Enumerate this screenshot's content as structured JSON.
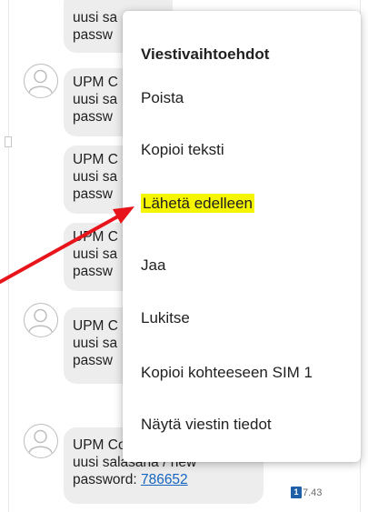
{
  "messages": [
    {
      "lines": [
        "uusi sa",
        "passw"
      ]
    },
    {
      "lines": [
        "UPM C",
        "uusi sa",
        "passw"
      ]
    },
    {
      "lines": [
        "UPM C",
        "uusi sa",
        "passw"
      ]
    },
    {
      "lines": [
        "UPM C",
        "uusi sa",
        "passw"
      ]
    },
    {
      "lines": [
        "UPM C",
        "uusi sa",
        "passw"
      ]
    },
    {
      "line1": "UPM Contractor Portal",
      "line2": "uusi salasana / new",
      "line3_prefix": "password: ",
      "code": "786652"
    }
  ],
  "timestamp": {
    "sim": "1",
    "time": "7.43"
  },
  "context_menu": {
    "title": "Viestivaihtoehdot",
    "items": [
      "Poista",
      "Kopioi teksti",
      "Lähetä edelleen",
      "Jaa",
      "Lukitse",
      "Kopioi kohteeseen SIM 1",
      "Näytä viestin tiedot"
    ],
    "highlighted_item": "Lähetä edelleen"
  },
  "colors": {
    "highlight": "#f5f500",
    "arrow": "#e8141b",
    "link": "#1565c0",
    "sim_badge": "#1f5fa8",
    "bubble": "#ededed"
  },
  "icons": [
    "contact-avatar-icon",
    "sim-1-badge-icon",
    "annotation-arrow"
  ]
}
